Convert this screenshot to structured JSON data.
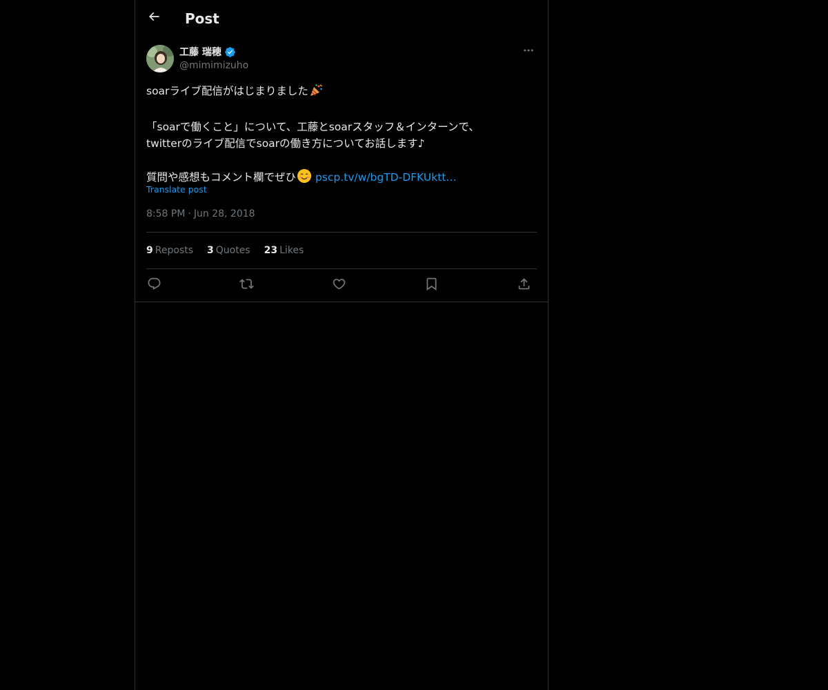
{
  "header": {
    "title": "Post",
    "back_icon": "arrow-left-icon"
  },
  "post": {
    "author": {
      "display_name": "工藤 瑞穂",
      "handle": "@mimimizuho",
      "verified": true,
      "verified_color": "#1d9bf0"
    },
    "text": {
      "line1": "soarライブ配信がはじまりました",
      "line1_emoji": "party-popper-icon",
      "line2": "「soarで働くこと」について、工藤とsoarスタッフ＆インターンで、",
      "line3": "twitterのライブ配信でsoarの働き方についてお話します♪",
      "line4": "質問や感想もコメント欄でぜひ",
      "line4_emoji": "smiling-face-icon",
      "link": "pscp.tv/w/bgTD-DFKUktt…"
    },
    "translate_label": "Translate post",
    "time": "8:58 PM",
    "separator": "·",
    "date": "Jun 28, 2018",
    "stats": [
      {
        "count": "9",
        "label": "Reposts"
      },
      {
        "count": "3",
        "label": "Quotes"
      },
      {
        "count": "23",
        "label": "Likes"
      }
    ],
    "actions": [
      "reply-icon",
      "repost-icon",
      "like-icon",
      "bookmark-icon",
      "share-icon"
    ]
  },
  "colors": {
    "background": "#000000",
    "text": "#e7e9ea",
    "muted": "#71767b",
    "accent": "#1d9bf0",
    "border": "#2f3336"
  }
}
